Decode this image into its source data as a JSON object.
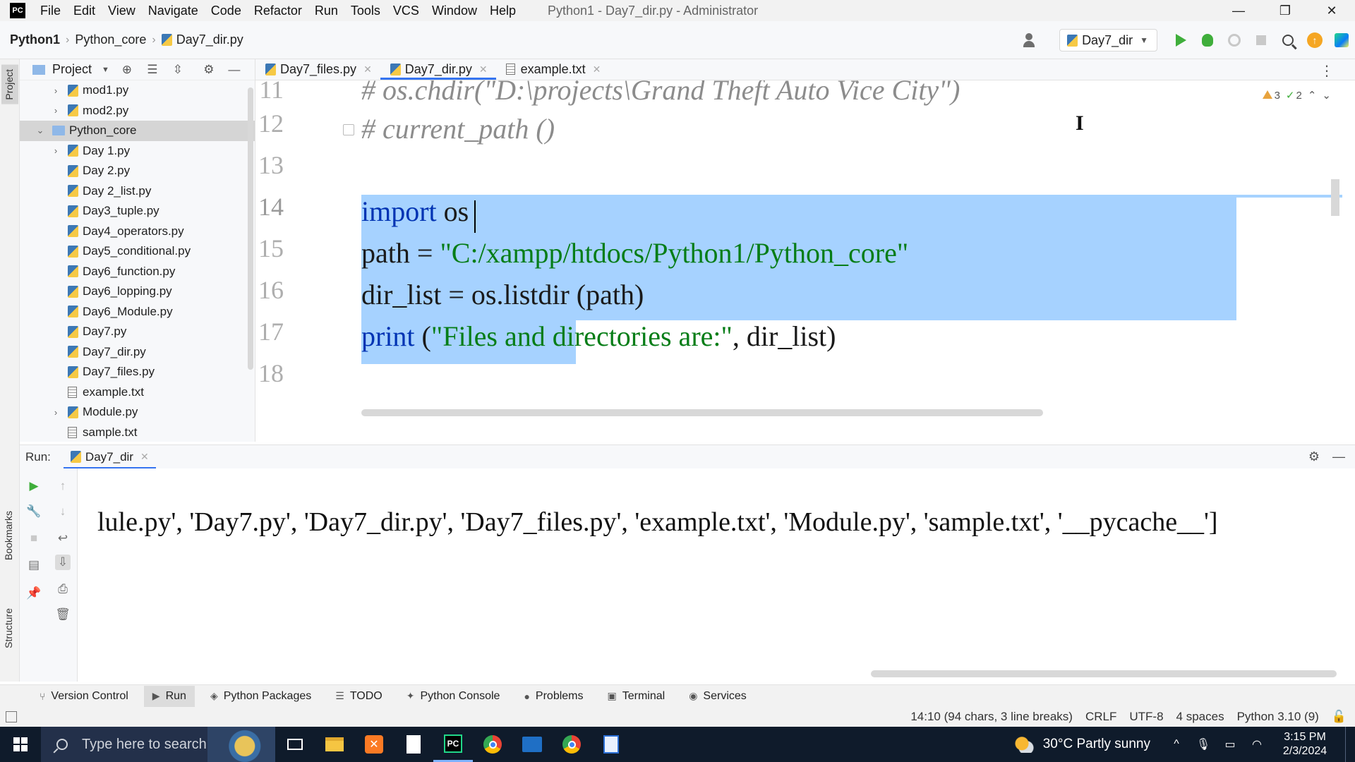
{
  "titlebar": {
    "logo": "PC",
    "menu": [
      "File",
      "Edit",
      "View",
      "Navigate",
      "Code",
      "Refactor",
      "Run",
      "Tools",
      "VCS",
      "Window",
      "Help"
    ],
    "window_title": "Python1 - Day7_dir.py - Administrator",
    "controls": {
      "minimize": "—",
      "restore": "❐",
      "close": "✕"
    }
  },
  "navbar": {
    "breadcrumb": [
      "Python1",
      "Python_core",
      "Day7_dir.py"
    ],
    "run_config": "Day7_dir"
  },
  "left_strip": {
    "project": "Project",
    "bookmarks": "Bookmarks",
    "structure": "Structure"
  },
  "project_panel": {
    "title": "Project",
    "tree": [
      {
        "label": "mod1.py",
        "type": "py",
        "indent": 1,
        "chevron": "›"
      },
      {
        "label": "mod2.py",
        "type": "py",
        "indent": 1,
        "chevron": "›"
      },
      {
        "label": "Python_core",
        "type": "folder",
        "indent": 0,
        "chevron": "⌄",
        "selected": true
      },
      {
        "label": "Day 1.py",
        "type": "py",
        "indent": 1,
        "chevron": "›"
      },
      {
        "label": "Day 2.py",
        "type": "py",
        "indent": 1,
        "chevron": ""
      },
      {
        "label": "Day 2_list.py",
        "type": "py",
        "indent": 1,
        "chevron": ""
      },
      {
        "label": "Day3_tuple.py",
        "type": "py",
        "indent": 1,
        "chevron": ""
      },
      {
        "label": "Day4_operators.py",
        "type": "py",
        "indent": 1,
        "chevron": ""
      },
      {
        "label": "Day5_conditional.py",
        "type": "py",
        "indent": 1,
        "chevron": ""
      },
      {
        "label": "Day6_function.py",
        "type": "py",
        "indent": 1,
        "chevron": ""
      },
      {
        "label": "Day6_lopping.py",
        "type": "py",
        "indent": 1,
        "chevron": ""
      },
      {
        "label": "Day6_Module.py",
        "type": "py",
        "indent": 1,
        "chevron": ""
      },
      {
        "label": "Day7.py",
        "type": "py",
        "indent": 1,
        "chevron": ""
      },
      {
        "label": "Day7_dir.py",
        "type": "py",
        "indent": 1,
        "chevron": ""
      },
      {
        "label": "Day7_files.py",
        "type": "py",
        "indent": 1,
        "chevron": ""
      },
      {
        "label": "example.txt",
        "type": "txt",
        "indent": 1,
        "chevron": ""
      },
      {
        "label": "Module.py",
        "type": "py",
        "indent": 1,
        "chevron": "›"
      },
      {
        "label": "sample.txt",
        "type": "txt",
        "indent": 1,
        "chevron": ""
      }
    ]
  },
  "editor": {
    "tabs": [
      {
        "label": "Day7_files.py",
        "type": "py",
        "active": false
      },
      {
        "label": "Day7_dir.py",
        "type": "py",
        "active": true
      },
      {
        "label": "example.txt",
        "type": "txt",
        "active": false
      }
    ],
    "inspections": {
      "warnings": "3",
      "weak_warnings": "2"
    },
    "line_numbers": [
      "11",
      "12",
      "13",
      "14",
      "15",
      "16",
      "17",
      "18"
    ],
    "lines": {
      "l11": "# os.chdir(\"D:\\projects\\Grand Theft Auto Vice City\")",
      "l12": "# current_path ()",
      "l14_kw": "import",
      "l14_rest": " os",
      "l15_a": "path = ",
      "l15_str": "\"C:/xampp/htdocs/Python1/Python_core\"",
      "l16": "dir_list = os.listdir (path)",
      "l17_fn": "print",
      "l17_a": " (",
      "l17_str": "\"Files and directories are:\"",
      "l17_b": ", dir_list)"
    }
  },
  "run_panel": {
    "label": "Run:",
    "tab": "Day7_dir",
    "output": "lule.py', 'Day7.py', 'Day7_dir.py', 'Day7_files.py', 'example.txt', 'Module.py', 'sample.txt', '__pycache__']"
  },
  "tool_tabs": [
    {
      "label": "Version Control",
      "icon": "branch-icon",
      "active": false
    },
    {
      "label": "Run",
      "icon": "run-icon",
      "active": true
    },
    {
      "label": "Python Packages",
      "icon": "packages-icon",
      "active": false
    },
    {
      "label": "TODO",
      "icon": "todo-icon",
      "active": false
    },
    {
      "label": "Python Console",
      "icon": "python-console-icon",
      "active": false
    },
    {
      "label": "Problems",
      "icon": "problems-icon",
      "active": false
    },
    {
      "label": "Terminal",
      "icon": "terminal-icon",
      "active": false
    },
    {
      "label": "Services",
      "icon": "services-icon",
      "active": false
    }
  ],
  "statusbar": {
    "position": "14:10 (94 chars, 3 line breaks)",
    "line_sep": "CRLF",
    "encoding": "UTF-8",
    "indent": "4 spaces",
    "interpreter": "Python 3.10 (9)"
  },
  "taskbar": {
    "search_placeholder": "Type here to search",
    "weather": "30°C  Partly sunny",
    "time": "3:15 PM",
    "date": "2/3/2024"
  },
  "colors": {
    "selection": "#a6d2ff",
    "keyword": "#0033b3",
    "string": "#067d17",
    "comment": "#8c8c8c",
    "accent": "#3574f0"
  }
}
